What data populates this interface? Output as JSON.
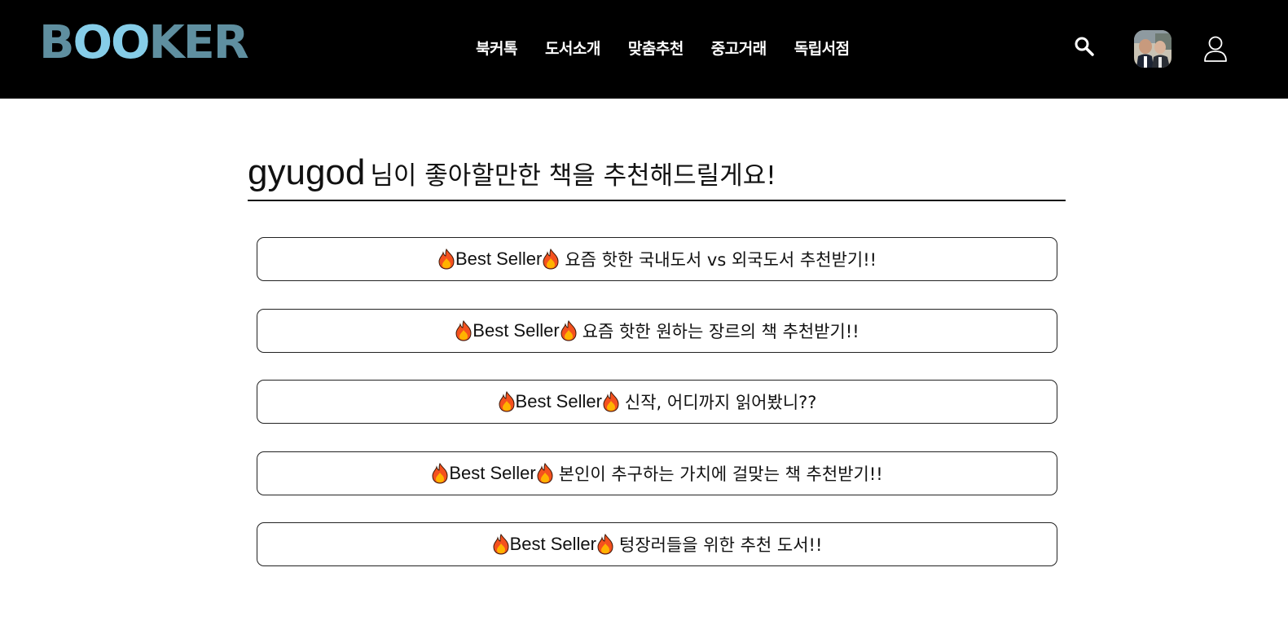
{
  "header": {
    "logo": "BOOKER",
    "nav": [
      "북커톡",
      "도서소개",
      "맞춤추천",
      "중고거래",
      "독립서점"
    ],
    "icons": {
      "search": "search-icon",
      "avatar": "avatar",
      "user": "user-icon"
    }
  },
  "main": {
    "username": "gyugod",
    "title": "님이 좋아할만한 책을 추천해드릴게요!",
    "badge_text": "Best Seller",
    "badge_icon": "fire-icon",
    "items": [
      "요즘 핫한 국내도서 vs 외국도서 추천받기!!",
      "요즘 핫한 원하는 장르의 책 추천받기!!",
      "신작, 어디까지 읽어봤니??",
      "본인이 추구하는 가치에 걸맞는 책 추천받기!!",
      "텅장러들을 위한 추천 도서!!"
    ]
  },
  "colors": {
    "header_bg": "#000000",
    "logo_main": "#5f8fa0",
    "logo_accent": "#86cde8",
    "nav_text": "#ffffff",
    "button_border": "#222222"
  }
}
